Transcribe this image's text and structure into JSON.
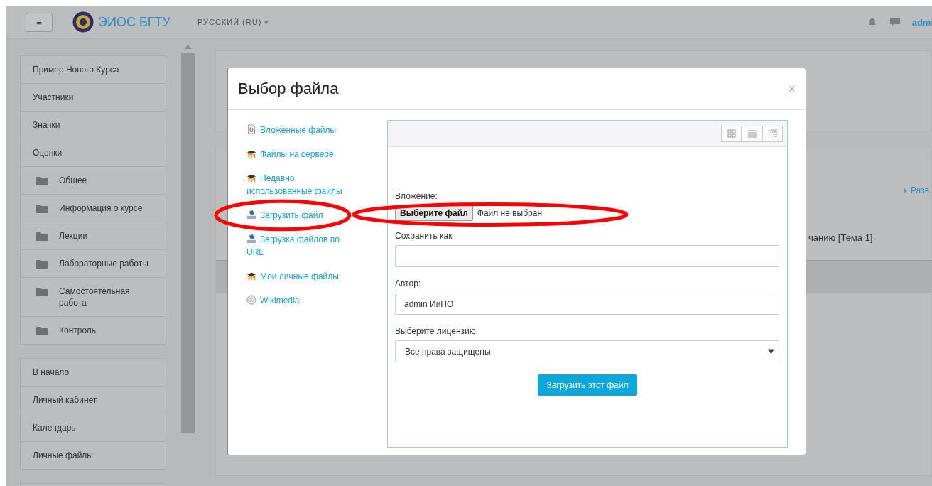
{
  "header": {
    "menu_button": "≡",
    "site_name": "ЭИОС БГТУ",
    "language": "РУССКИЙ (RU)",
    "language_caret": "▾",
    "user": "admi"
  },
  "sidebar": {
    "groups": [
      {
        "items": [
          {
            "label": "Пример Нового Курса",
            "kind": "link"
          },
          {
            "label": "Участники",
            "kind": "link"
          },
          {
            "label": "Значки",
            "kind": "link"
          },
          {
            "label": "Оценки",
            "kind": "link"
          },
          {
            "label": "Общее",
            "kind": "folder"
          },
          {
            "label": "Информация о курсе",
            "kind": "folder"
          },
          {
            "label": "Лекции",
            "kind": "folder"
          },
          {
            "label": "Лабораторные работы",
            "kind": "folder"
          },
          {
            "label": "Самостоятельная работа",
            "kind": "folder"
          },
          {
            "label": "Контроль",
            "kind": "folder"
          }
        ]
      },
      {
        "items": [
          {
            "label": "В начало",
            "kind": "link"
          },
          {
            "label": "Личный кабинет",
            "kind": "link"
          },
          {
            "label": "Календарь",
            "kind": "link"
          },
          {
            "label": "Личные файлы",
            "kind": "link"
          }
        ]
      },
      {
        "items": [
          {
            "kind": "stub"
          }
        ]
      }
    ]
  },
  "background": {
    "section_link": "Разв",
    "activity_text": "чанию [Тема 1]"
  },
  "dialog": {
    "title": "Выбор файла",
    "close": "×",
    "repositories": [
      {
        "label": "Вложенные файлы",
        "kind": "attachment"
      },
      {
        "label": "Файлы на сервере",
        "kind": "server"
      },
      {
        "label": "Недавно использованные файлы",
        "kind": "server"
      },
      {
        "label": "Загрузить файл",
        "kind": "upload"
      },
      {
        "label": "Загрузка файлов по URL",
        "kind": "upload"
      },
      {
        "label": "Мои личные файлы",
        "kind": "server"
      },
      {
        "label": "Wikimedia",
        "kind": "wiki"
      }
    ],
    "views": [
      {
        "kind": "icons"
      },
      {
        "kind": "list"
      },
      {
        "kind": "tree"
      }
    ],
    "form": {
      "attachment_label": "Вложение:",
      "choose_button": "Выберите файл",
      "no_file": "Файл не выбран",
      "save_as_label": "Сохранить как",
      "author_label": "Автор:",
      "author_value": "admin ИиПО",
      "license_label": "Выберите лицензию",
      "license_value": "Все права защищены",
      "submit": "Загрузить этот файл"
    }
  },
  "annotations": [
    {
      "kind": "ellipse"
    },
    {
      "kind": "ellipse"
    }
  ]
}
